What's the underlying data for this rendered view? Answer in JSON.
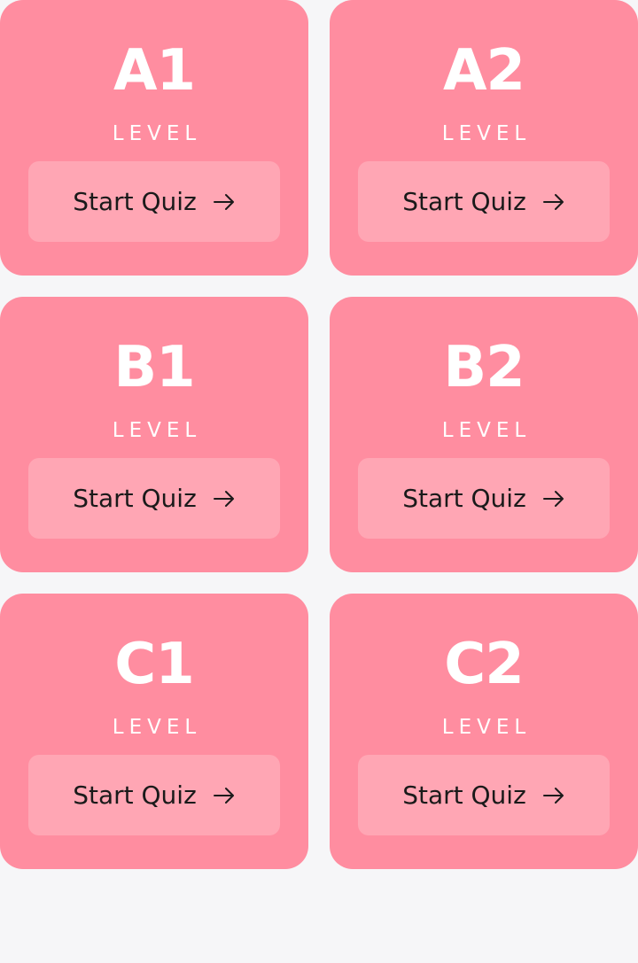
{
  "cards": [
    {
      "code": "A1",
      "label": "LEVEL",
      "button": "Start Quiz"
    },
    {
      "code": "A2",
      "label": "LEVEL",
      "button": "Start Quiz"
    },
    {
      "code": "B1",
      "label": "LEVEL",
      "button": "Start Quiz"
    },
    {
      "code": "B2",
      "label": "LEVEL",
      "button": "Start Quiz"
    },
    {
      "code": "C1",
      "label": "LEVEL",
      "button": "Start Quiz"
    },
    {
      "code": "C2",
      "label": "LEVEL",
      "button": "Start Quiz"
    }
  ],
  "icons": {
    "button_icon": "arrow-right-icon"
  },
  "colors": {
    "card": "#ff8da0",
    "button": "#ffa6b4",
    "background": "#f6f6f8",
    "text_light": "#ffffff",
    "text_dark": "#1a1a1a"
  }
}
